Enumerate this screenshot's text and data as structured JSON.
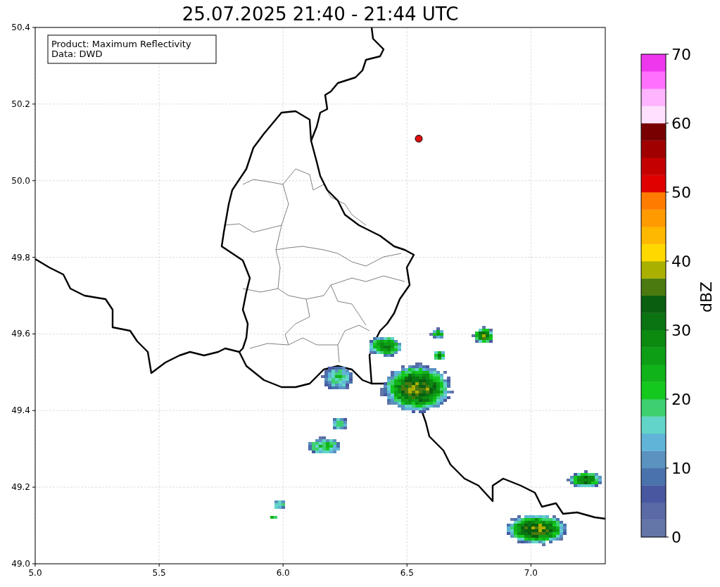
{
  "title": "25.07.2025 21:40 - 21:44 UTC",
  "info_box": {
    "lines": [
      "Product: Maximum Reflectivity",
      "Data: DWD"
    ]
  },
  "map": {
    "xticks": [
      "5.0",
      "5.5",
      "6.0",
      "6.5",
      "7.0"
    ],
    "yticks": [
      "50.4",
      "50.2",
      "50.0",
      "49.8",
      "49.6",
      "49.4",
      "49.2",
      "49.0"
    ]
  },
  "colorbar": {
    "label": "dBZ",
    "ticks": [
      "70",
      "60",
      "50",
      "40",
      "30",
      "20",
      "10",
      "0"
    ],
    "bins": [
      {
        "color": "#6476a8"
      },
      {
        "color": "#5a6aa6"
      },
      {
        "color": "#4858a0"
      },
      {
        "color": "#4a72ac"
      },
      {
        "color": "#5a92c0"
      },
      {
        "color": "#60b4d8"
      },
      {
        "color": "#62d4c8"
      },
      {
        "color": "#3ed070"
      },
      {
        "color": "#14c81e"
      },
      {
        "color": "#10b41a"
      },
      {
        "color": "#0e9e16"
      },
      {
        "color": "#0c8a10"
      },
      {
        "color": "#0a7412"
      },
      {
        "color": "#0a5e10"
      },
      {
        "color": "#4a7a10"
      },
      {
        "color": "#aab000"
      },
      {
        "color": "#ffd800"
      },
      {
        "color": "#ffb800"
      },
      {
        "color": "#ff9a00"
      },
      {
        "color": "#ff7c00"
      },
      {
        "color": "#e00000"
      },
      {
        "color": "#c40000"
      },
      {
        "color": "#a00000"
      },
      {
        "color": "#780000"
      },
      {
        "color": "#ffe0ff"
      },
      {
        "color": "#ffb4ff"
      },
      {
        "color": "#ff70ff"
      },
      {
        "color": "#ee38ee"
      }
    ]
  }
}
